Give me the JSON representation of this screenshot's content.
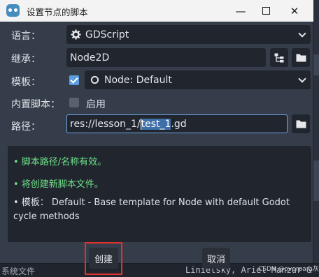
{
  "window": {
    "title": "设置节点的脚本",
    "minimize": "—",
    "close": "✕"
  },
  "form": {
    "language_label": "语言：",
    "language_value": "GDScript",
    "inherits_label": "继承：",
    "inherits_value": "Node2D",
    "template_label": "模板：",
    "template_checked": true,
    "template_value": "Node: Default",
    "builtin_label": "内置脚本：",
    "builtin_checked": false,
    "builtin_option": "启用",
    "path_label": "路径：",
    "path_prefix": "res://lesson_1/",
    "path_selected": "test_1",
    "path_suffix": ".gd"
  },
  "info": {
    "line1": "• 脚本路径/名称有效。",
    "line2": "• 将创建新脚本文件。",
    "line3": "• 模板： Default - Base template for Node with default Godot cycle methods"
  },
  "buttons": {
    "create": "创建",
    "cancel": "取消"
  },
  "background": {
    "code_text": "Linietsky, Ariel Manzur &",
    "filesystem_text": "系统文件",
    "watermark": "CSDN @overpara灰"
  },
  "colors": {
    "accent": "#6fa6e3",
    "success": "#6fe08a",
    "highlight": "#e0312c"
  }
}
